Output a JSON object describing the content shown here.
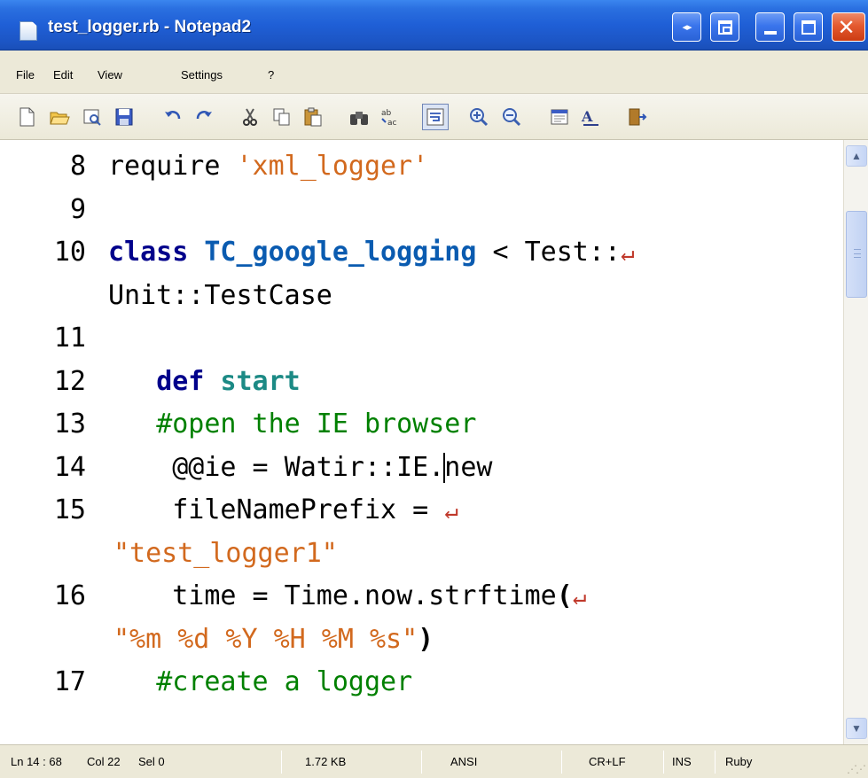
{
  "window": {
    "title": "test_logger.rb - Notepad2",
    "controls": [
      "arrows-icon",
      "restore-icon",
      "minimize-icon",
      "maximize-icon",
      "close-icon"
    ]
  },
  "menu": {
    "items": [
      "File",
      "Edit",
      "View",
      "Settings",
      "?"
    ]
  },
  "toolbar": {
    "tools": [
      "new-file",
      "open-file",
      "browse",
      "save",
      "undo",
      "redo",
      "cut",
      "copy",
      "paste",
      "find",
      "replace",
      "word-wrap",
      "zoom-in",
      "zoom-out",
      "view-options",
      "font",
      "exit"
    ]
  },
  "editor": {
    "lines": [
      {
        "num": "8",
        "parts": [
          [
            "",
            "require "
          ],
          [
            "str",
            "'xml_logger'"
          ]
        ]
      },
      {
        "num": "9",
        "parts": []
      },
      {
        "num": "10",
        "parts": [
          [
            "kw",
            "class "
          ],
          [
            "cls",
            "TC_google_logging"
          ],
          [
            "",
            " < Test::"
          ]
        ],
        "wrap": true
      },
      {
        "num": "",
        "parts": [
          [
            "",
            "Unit::TestCase"
          ]
        ]
      },
      {
        "num": "11",
        "parts": []
      },
      {
        "num": "12",
        "parts": [
          [
            "",
            "   "
          ],
          [
            "kw",
            "def "
          ],
          [
            "def",
            "start"
          ]
        ]
      },
      {
        "num": "13",
        "parts": [
          [
            "",
            "   "
          ],
          [
            "cmt",
            "#open the IE browser"
          ]
        ]
      },
      {
        "num": "14",
        "parts": [
          [
            "",
            "    @@ie = Watir::IE."
          ],
          [
            "caret",
            ""
          ],
          [
            "",
            "new"
          ]
        ]
      },
      {
        "num": "15",
        "parts": [
          [
            "",
            "    fileNamePrefix = "
          ]
        ],
        "wrap": true
      },
      {
        "num": "",
        "parts": [
          [
            "str",
            "\"test_logger1\""
          ]
        ],
        "wrapcont": true
      },
      {
        "num": "16",
        "parts": [
          [
            "",
            "    time = Time.now.strftime"
          ],
          [
            "par",
            "("
          ]
        ],
        "wrap": true
      },
      {
        "num": "",
        "parts": [
          [
            "str",
            "\"%m %d %Y %H %M %s\""
          ],
          [
            "par",
            ")"
          ]
        ],
        "wrapcont": true
      },
      {
        "num": "17",
        "parts": [
          [
            "",
            "   "
          ],
          [
            "cmt",
            "#create a logger"
          ]
        ]
      }
    ]
  },
  "status": {
    "position": "Ln 14 : 68",
    "column": "Col 22",
    "selection": "Sel 0",
    "size": "1.72 KB",
    "encoding": "ANSI",
    "line_endings": "CR+LF",
    "mode": "INS",
    "language": "Ruby"
  },
  "colors": {
    "title_bar": "#1f5fd6",
    "keyword": "#00008b",
    "class_name": "#0a5bb0",
    "method_name": "#1c8a85",
    "string": "#d2691e",
    "comment": "#008000",
    "wrap_marker": "#c0392b"
  }
}
